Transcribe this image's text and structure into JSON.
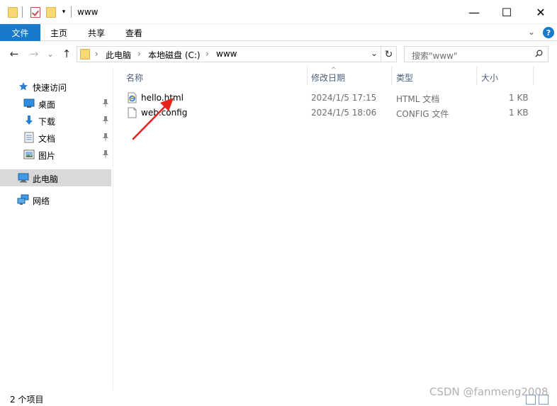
{
  "window": {
    "title": "www",
    "minimize": "—",
    "maximize": "☐",
    "close": "✕"
  },
  "ribbon": {
    "tabs": [
      "文件",
      "主页",
      "共享",
      "查看"
    ],
    "accent": "#1979ca",
    "collapse": "⌄",
    "help": "?"
  },
  "nav": {
    "back": "←",
    "forward": "→",
    "recent": "⌄",
    "up": "↑",
    "breadcrumb": [
      "此电脑",
      "本地磁盘 (C:)",
      "www"
    ],
    "separator": "›",
    "dropdown": "⌄",
    "refresh": "↻",
    "search_placeholder": "搜索\"www\""
  },
  "sidebar": {
    "quick_access": "快速访问",
    "items": [
      {
        "label": "桌面",
        "icon": "desktop-icon",
        "pinned": true
      },
      {
        "label": "下载",
        "icon": "download-icon",
        "pinned": true
      },
      {
        "label": "文档",
        "icon": "document-icon",
        "pinned": true
      },
      {
        "label": "图片",
        "icon": "pictures-icon",
        "pinned": true
      }
    ],
    "this_pc": "此电脑",
    "network": "网络",
    "pin_glyph": "📌"
  },
  "columns": [
    "名称",
    "修改日期",
    "类型",
    "大小"
  ],
  "sort_glyph": "^",
  "files": [
    {
      "name": "hello.html",
      "modified": "2024/1/5 17:15",
      "type": "HTML 文档",
      "size": "1 KB",
      "icon": "html-file-icon"
    },
    {
      "name": "web.config",
      "modified": "2024/1/5 18:06",
      "type": "CONFIG 文件",
      "size": "1 KB",
      "icon": "config-file-icon"
    }
  ],
  "status": {
    "count": "2 个项目"
  },
  "watermark": "CSDN @fanmeng2008"
}
